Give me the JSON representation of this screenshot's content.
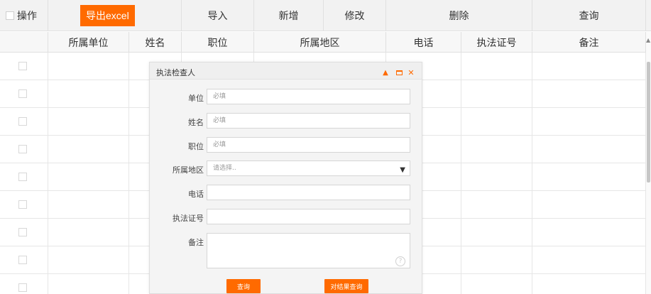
{
  "toolbar": {
    "op_label": "操作",
    "export_label": "导出excel",
    "import_label": "导入",
    "add_label": "新增",
    "edit_label": "修改",
    "delete_label": "删除",
    "query_label": "查询"
  },
  "table": {
    "columns": [
      "所属单位",
      "姓名",
      "职位",
      "所属地区",
      "电话",
      "执法证号",
      "备注"
    ],
    "rows_visible": 9
  },
  "dialog": {
    "title": "执法检查人",
    "fields": {
      "unit": {
        "label": "单位",
        "placeholder": "必填"
      },
      "name": {
        "label": "姓名",
        "placeholder": "必填"
      },
      "position": {
        "label": "职位",
        "placeholder": "必填"
      },
      "region": {
        "label": "所属地区",
        "placeholder": "请选择.."
      },
      "phone": {
        "label": "电话",
        "placeholder": ""
      },
      "license": {
        "label": "执法证号",
        "placeholder": ""
      },
      "remark": {
        "label": "备注",
        "placeholder": ""
      }
    },
    "query_button": "查询",
    "result_query_button": "对结果查询"
  },
  "colors": {
    "accent": "#ff6a00"
  }
}
